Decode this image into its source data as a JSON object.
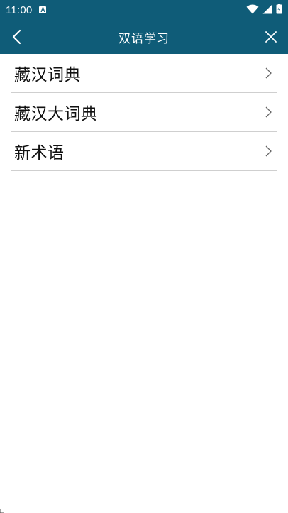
{
  "status_bar": {
    "time": "11:00",
    "notification_icon": "a-badge-icon",
    "icons": [
      "wifi-icon",
      "signal-icon",
      "battery-icon"
    ]
  },
  "header": {
    "title": "双语学习",
    "back_icon": "back-chevron-icon",
    "close_icon": "close-icon",
    "background_color": "#0f5c78"
  },
  "list": {
    "items": [
      {
        "label": "藏汉词典",
        "icon": "chevron-right-icon"
      },
      {
        "label": "藏汉大词典",
        "icon": "chevron-right-icon"
      },
      {
        "label": "新术语",
        "icon": "chevron-right-icon"
      }
    ]
  }
}
